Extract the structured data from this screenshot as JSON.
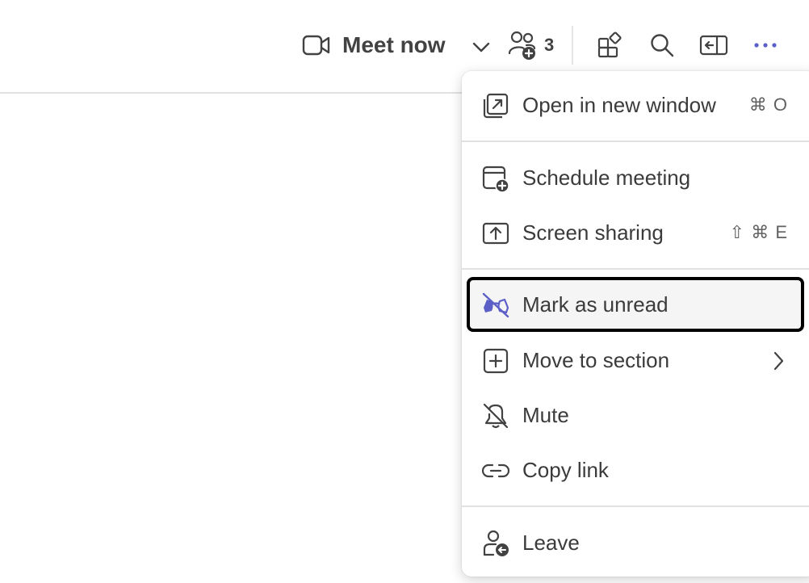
{
  "toolbar": {
    "meet_now_label": "Meet now",
    "participants_count": "3"
  },
  "menu": {
    "items": [
      {
        "label": "Open in new window",
        "shortcut": "⌘ O",
        "icon": "open-window-icon"
      },
      {
        "label": "Schedule meeting",
        "shortcut": "",
        "icon": "calendar-add-icon"
      },
      {
        "label": "Screen sharing",
        "shortcut": "⇧ ⌘ E",
        "icon": "screen-share-icon"
      },
      {
        "label": "Mark as unread",
        "shortcut": "",
        "icon": "eye-off-icon"
      },
      {
        "label": "Move to section",
        "shortcut": "",
        "icon": "add-square-icon"
      },
      {
        "label": "Mute",
        "shortcut": "",
        "icon": "bell-off-icon"
      },
      {
        "label": "Copy link",
        "shortcut": "",
        "icon": "link-icon"
      },
      {
        "label": "Leave",
        "shortcut": "",
        "icon": "person-leave-icon"
      }
    ]
  },
  "colors": {
    "accent": "#5b5fc7",
    "focus_border": "#000000",
    "icon": "#424242"
  }
}
